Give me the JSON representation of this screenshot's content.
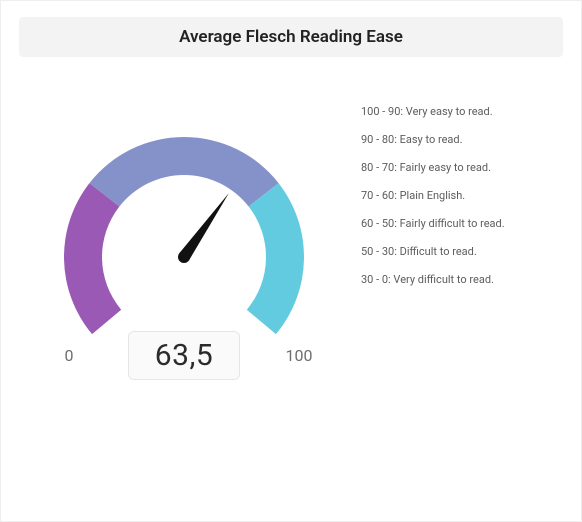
{
  "title": "Average Flesch Reading Ease",
  "chart_data": {
    "type": "gauge",
    "min": 0,
    "max": 100,
    "value": 63.5,
    "value_display": "63,5",
    "min_label": "0",
    "max_label": "100",
    "segments": [
      {
        "from": 0,
        "to": 30,
        "color": "#9b59b6"
      },
      {
        "from": 30,
        "to": 70,
        "color": "#8591c9"
      },
      {
        "from": 70,
        "to": 100,
        "color": "#62cbe0"
      }
    ]
  },
  "legend": [
    "100 - 90: Very easy to read.",
    "90 - 80: Easy to read.",
    "80 - 70: Fairly easy to read.",
    "70 - 60: Plain English.",
    "60 - 50: Fairly difficult to read.",
    "50 - 30: Difficult to read.",
    "30 - 0: Very difficult to read."
  ]
}
